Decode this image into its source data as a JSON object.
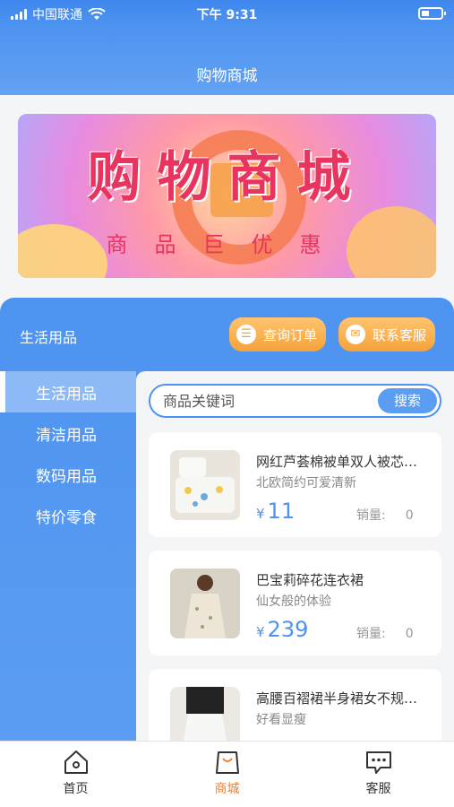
{
  "statusbar": {
    "carrier": "中国联通",
    "time": "下午 9:31"
  },
  "navbar": {
    "title": "购物商城"
  },
  "banner": {
    "title": "购物商城",
    "subtitle": "商品巨优惠"
  },
  "panel": {
    "category_title": "生活用品",
    "order_button": "查询订单",
    "service_button": "联系客服"
  },
  "sidebar": {
    "items": [
      {
        "label": "生活用品",
        "active": true
      },
      {
        "label": "清洁用品",
        "active": false
      },
      {
        "label": "数码用品",
        "active": false
      },
      {
        "label": "特价零食",
        "active": false
      }
    ]
  },
  "search": {
    "placeholder": "商品关键词",
    "button": "搜索"
  },
  "products": [
    {
      "name": "网红芦荟棉被单双人被芯…",
      "desc": "北欧简约可爱清新",
      "currency": "¥",
      "price": "11",
      "sales_label": "销量:",
      "sales": "0"
    },
    {
      "name": "巴宝莉碎花连衣裙",
      "desc": "仙女般的体验",
      "currency": "¥",
      "price": "239",
      "sales_label": "销量:",
      "sales": "0"
    },
    {
      "name": "高腰百褶裙半身裙女不规…",
      "desc": "好看显瘦",
      "currency": "¥",
      "price": "",
      "sales_label": "",
      "sales": ""
    }
  ],
  "tabbar": {
    "items": [
      {
        "label": "首页",
        "icon": "home-icon",
        "active": false
      },
      {
        "label": "商城",
        "icon": "shopping-bag-icon",
        "active": true
      },
      {
        "label": "客服",
        "icon": "chat-icon",
        "active": false
      }
    ]
  },
  "colors": {
    "primary": "#4d93f0",
    "accent": "#f5a23a",
    "tab_active": "#e9823b"
  }
}
